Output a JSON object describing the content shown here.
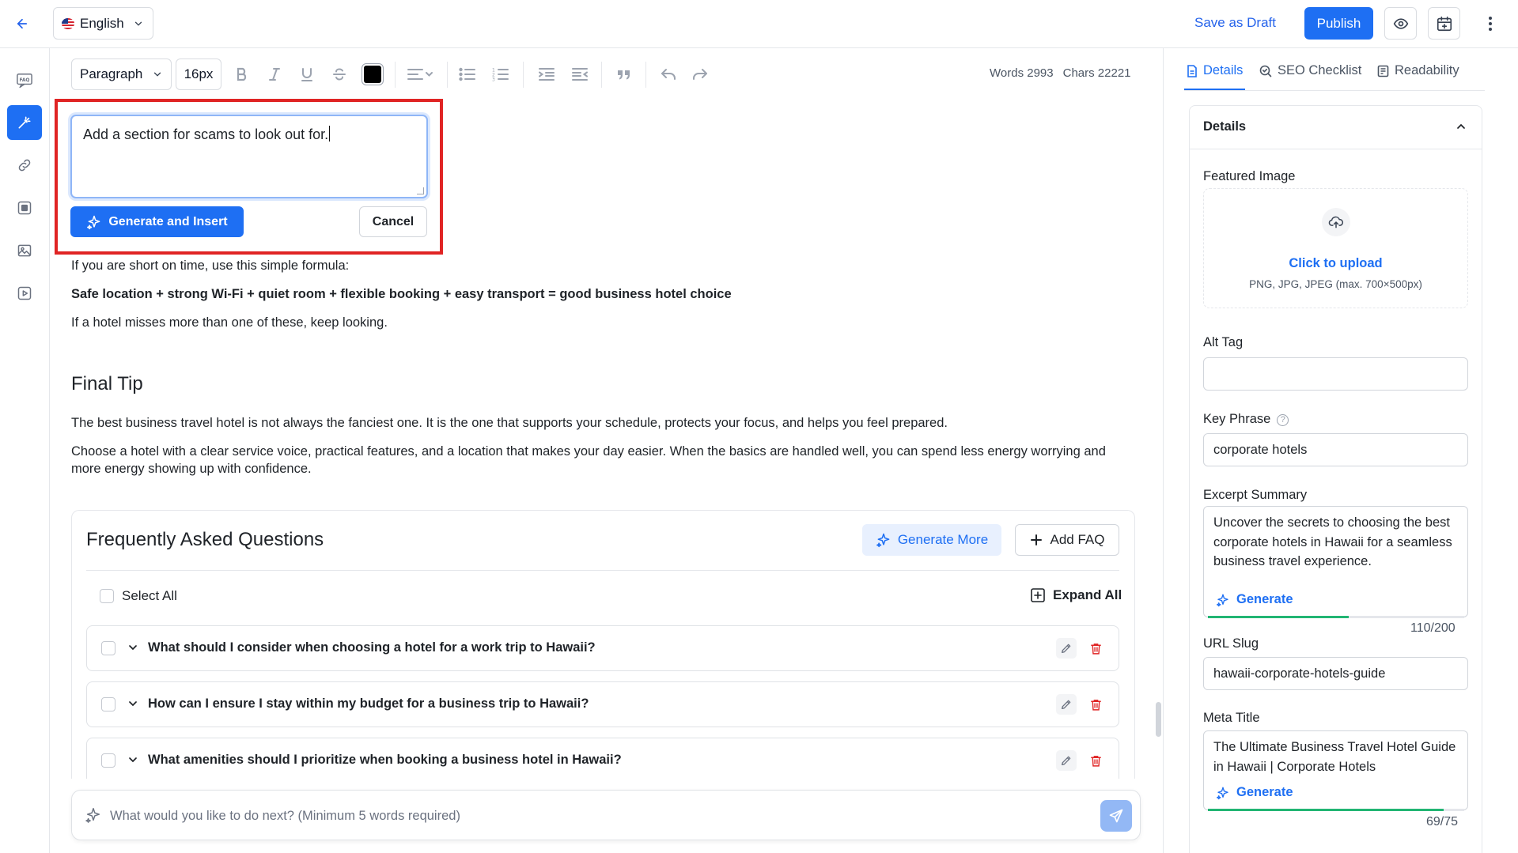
{
  "topbar": {
    "language": "English",
    "save_draft_label": "Save as Draft",
    "publish_label": "Publish"
  },
  "toolbar": {
    "block_type": "Paragraph",
    "font_size": "16px",
    "text_color": "#000000",
    "words": "Words 2993",
    "chars": "Chars 22221"
  },
  "prompt": {
    "text": "Add a section for scams to look out for.",
    "generate_label": "Generate and Insert",
    "cancel_label": "Cancel"
  },
  "content": {
    "formula_intro": "If you are short on time, use this simple formula:",
    "formula": "Safe location + strong Wi-Fi + quiet room + flexible booking + easy transport = good business hotel choice",
    "formula_note": "If a hotel misses more than one of these, keep looking.",
    "heading": "Final Tip",
    "para1": "The best business travel hotel is not always the fanciest one. It is the one that supports your schedule, protects your focus, and helps you feel prepared.",
    "para2": "Choose a hotel with a clear service voice, practical features, and a location that makes your day easier. When the basics are handled well, you can spend less energy worrying and more energy showing up with confidence."
  },
  "faq": {
    "title": "Frequently Asked Questions",
    "generate_more_label": "Generate More",
    "add_label": "Add FAQ",
    "select_all_label": "Select All",
    "expand_all_label": "Expand All",
    "items": [
      {
        "question": "What should I consider when choosing a hotel for a work trip to Hawaii?"
      },
      {
        "question": "How can I ensure I stay within my budget for a business trip to Hawaii?"
      },
      {
        "question": "What amenities should I prioritize when booking a business hotel in Hawaii?"
      }
    ]
  },
  "command": {
    "placeholder": "What would you like to do next? (Minimum 5 words required)"
  },
  "panel": {
    "tabs": [
      {
        "label": "Details"
      },
      {
        "label": "SEO Checklist"
      },
      {
        "label": "Readability"
      }
    ],
    "details_title": "Details",
    "featured_image_label": "Featured Image",
    "upload_cta": "Click to upload",
    "upload_hint": "PNG, JPG, JPEG (max. 700×500px)",
    "alt_tag_label": "Alt Tag",
    "alt_tag_value": "",
    "key_phrase_label": "Key Phrase",
    "key_phrase_value": "corporate hotels",
    "excerpt_label": "Excerpt Summary",
    "excerpt_value": "Uncover the secrets to choosing the best corporate hotels in Hawaii for a seamless business travel experience.",
    "excerpt_generate_label": "Generate",
    "excerpt_count": "110/200",
    "excerpt_progress": 0.55,
    "slug_label": "URL Slug",
    "slug_value": "hawaii-corporate-hotels-guide",
    "meta_title_label": "Meta Title",
    "meta_title_value": "The Ultimate Business Travel Hotel Guide in Hawaii | Corporate Hotels",
    "meta_generate_label": "Generate",
    "meta_count": "69/75",
    "meta_progress": 0.92
  },
  "colors": {
    "accent": "#1e6ff3",
    "danger": "#e02424",
    "success": "#22b573"
  }
}
